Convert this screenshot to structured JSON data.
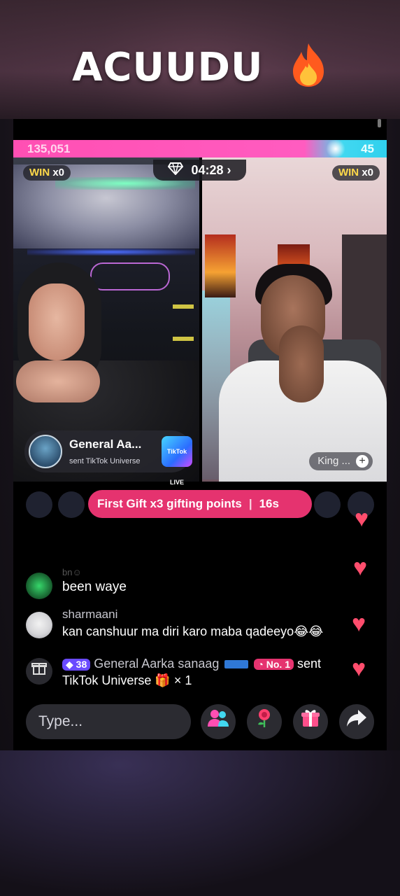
{
  "overlay": {
    "title": "ACUUDU",
    "emoji": "🔥"
  },
  "battle": {
    "score_left": "135,051",
    "score_right": "45",
    "left_win_label": "WIN",
    "left_win_count": "x0",
    "right_win_label": "WIN",
    "right_win_count": "x0",
    "timer": "04:28",
    "timer_chevron": "›"
  },
  "gift_card": {
    "name": "General Aa...",
    "subtitle": "sent TikTok Universe",
    "gift_thumb": "TikTok LIVE"
  },
  "right_tag": {
    "label": "King ...",
    "plus": "+"
  },
  "first_gift_banner": {
    "text": "First Gift x3 gifting points",
    "separator": "|",
    "countdown": "16s"
  },
  "chat": [
    {
      "user": "bn☺",
      "text": "been waye"
    },
    {
      "user": "sharmaani",
      "text": "kan canshuur ma diri karo maba qadeeyo😂😂"
    }
  ],
  "system_message": {
    "level": "38",
    "user": "General Aarka sanaag",
    "rank": "No. 1",
    "action": "sent",
    "line2": "TikTok Universe",
    "gift_icon": "🎁",
    "count": "× 1"
  },
  "bottom": {
    "input_placeholder": "Type...",
    "icons": [
      "multi-guest-icon",
      "rose-icon",
      "gift-icon",
      "share-icon"
    ]
  },
  "colors": {
    "score_pink": "#ff4fb3",
    "score_cyan": "#2fd0ee",
    "banner_pink": "#e5336f",
    "heart": "#ff4d6d",
    "win_yellow": "#ffd94a"
  }
}
